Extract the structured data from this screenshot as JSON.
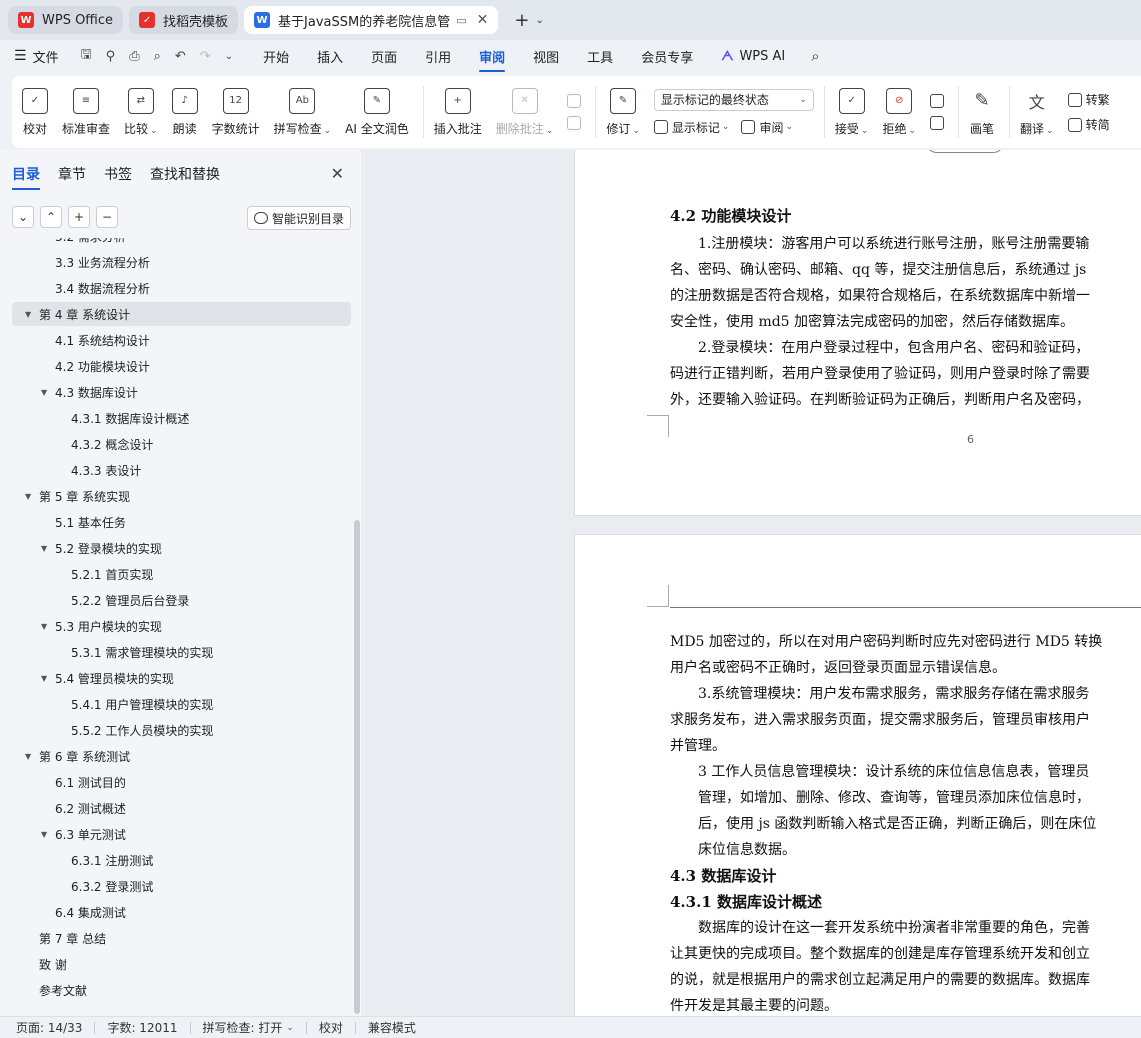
{
  "tabs": [
    {
      "label": "WPS Office",
      "icon": "wps-logo-icon",
      "active": false
    },
    {
      "label": "找稻壳模板",
      "icon": "daoke-icon",
      "active": false
    },
    {
      "label": "基于JavaSSM的养老院信息管",
      "icon": "word-doc-icon",
      "active": true
    }
  ],
  "menu": {
    "file": "文件",
    "items": [
      "开始",
      "插入",
      "页面",
      "引用",
      "审阅",
      "视图",
      "工具",
      "会员专享"
    ],
    "active": "审阅",
    "wps_ai": "WPS AI"
  },
  "ribbon": {
    "proofread": "校对",
    "standard_review": "标准审查",
    "compare": "比较",
    "read_aloud": "朗读",
    "word_count": "字数统计",
    "spell_check": "拼写检查",
    "ai_polish": "AI 全文润色",
    "insert_comment": "插入批注",
    "delete_comment": "删除批注",
    "track_changes": "修订",
    "markup_select": "显示标记的最终状态",
    "show_markup": "显示标记",
    "review": "审阅",
    "accept": "接受",
    "reject": "拒绝",
    "pen": "画笔",
    "translate": "翻译",
    "to_traditional": "转繁",
    "to_simplified": "转简"
  },
  "nav": {
    "tabs": [
      "目录",
      "章节",
      "书签",
      "查找和替换"
    ],
    "active": "目录",
    "smart_toc": "智能识别目录"
  },
  "toc": [
    {
      "label": "3.2 需求分析",
      "level": 2,
      "arrow": false
    },
    {
      "label": "3.3 业务流程分析",
      "level": 2,
      "arrow": false
    },
    {
      "label": "3.4 数据流程分析",
      "level": 2,
      "arrow": false
    },
    {
      "label": "第 4 章  系统设计",
      "level": 1,
      "arrow": true,
      "selected": true
    },
    {
      "label": "4.1 系统结构设计",
      "level": 2,
      "arrow": false
    },
    {
      "label": "4.2 功能模块设计",
      "level": 2,
      "arrow": false
    },
    {
      "label": "4.3 数据库设计",
      "level": 2,
      "arrow": true
    },
    {
      "label": "4.3.1 数据库设计概述",
      "level": 3,
      "arrow": false
    },
    {
      "label": "4.3.2 概念设计",
      "level": 3,
      "arrow": false
    },
    {
      "label": "4.3.3 表设计",
      "level": 3,
      "arrow": false
    },
    {
      "label": "第 5 章    系统实现",
      "level": 1,
      "arrow": true
    },
    {
      "label": "5.1 基本任务",
      "level": 2,
      "arrow": false
    },
    {
      "label": "5.2 登录模块的实现",
      "level": 2,
      "arrow": true
    },
    {
      "label": "5.2.1 首页实现",
      "level": 3,
      "arrow": false
    },
    {
      "label": "5.2.2 管理员后台登录",
      "level": 3,
      "arrow": false
    },
    {
      "label": "5.3 用户模块的实现",
      "level": 2,
      "arrow": true
    },
    {
      "label": "5.3.1 需求管理模块的实现",
      "level": 3,
      "arrow": false
    },
    {
      "label": "5.4 管理员模块的实现",
      "level": 2,
      "arrow": true
    },
    {
      "label": "5.4.1 用户管理模块的实现",
      "level": 3,
      "arrow": false
    },
    {
      "label": "5.5.2 工作人员模块的实现",
      "level": 3,
      "arrow": false
    },
    {
      "label": "第 6 章    系统测试",
      "level": 1,
      "arrow": true
    },
    {
      "label": "6.1 测试目的",
      "level": 2,
      "arrow": false
    },
    {
      "label": "6.2 测试概述",
      "level": 2,
      "arrow": false
    },
    {
      "label": "6.3 单元测试",
      "level": 2,
      "arrow": true
    },
    {
      "label": "6.3.1 注册测试",
      "level": 3,
      "arrow": false
    },
    {
      "label": "6.3.2 登录测试",
      "level": 3,
      "arrow": false
    },
    {
      "label": "6.4 集成测试",
      "level": 2,
      "arrow": false
    },
    {
      "label": "第 7 章    总结",
      "level": 1,
      "arrow": false
    },
    {
      "label": "致   谢",
      "level": 1,
      "arrow": false
    },
    {
      "label": "参考文献",
      "level": 1,
      "arrow": false
    }
  ],
  "page1": {
    "heading": "4.2 功能模块设计",
    "lines": [
      "　　1.注册模块：游客用户可以系统进行账号注册，账号注册需要输",
      "名、密码、确认密码、邮箱、qq 等，提交注册信息后，系统通过 js",
      "的注册数据是否符合规格，如果符合规格后，在系统数据库中新增一",
      "安全性，使用 md5 加密算法完成密码的加密，然后存储数据库。",
      "　　2.登录模块：在用户登录过程中，包含用户名、密码和验证码，",
      "码进行正错判断，若用户登录使用了验证码，则用户登录时除了需要",
      "外，还要输入验证码。在判断验证码为正确后，判断用户名及密码，"
    ],
    "page_number": "6"
  },
  "page2": {
    "lines": [
      "MD5 加密过的，所以在对用户密码判断时应先对密码进行 MD5 转换",
      "用户名或密码不正确时，返回登录页面显示错误信息。",
      "　　3.系统管理模块：用户发布需求服务，需求服务存储在需求服务",
      "求服务发布，进入需求服务页面，提交需求服务后，管理员审核用户",
      "并管理。",
      "　　3 工作人员信息管理模块：设计系统的床位信息信息表，管理员",
      "　　管理，如增加、删除、修改、查询等，管理员添加床位信息时，",
      "　　后，使用 js 函数判断输入格式是否正确，判断正确后，则在床位",
      "　　床位信息数据。"
    ],
    "heading1": "4.3 数据库设计",
    "heading2": "4.3.1 数据库设计概述",
    "lines2": [
      "　　数据库的设计在这一套开发系统中扮演者非常重要的角色，完善",
      "让其更快的完成项目。整个数据库的创建是库存管理系统开发和创立",
      "的说，就是根据用户的需求创立起满足用户的需要的数据库。数据库",
      "件开发是其最主要的问题。"
    ]
  },
  "status": {
    "page": "页面: 14/33",
    "words": "字数: 12011",
    "spell": "拼写检查: 打开",
    "proof": "校对",
    "compat": "兼容模式"
  }
}
